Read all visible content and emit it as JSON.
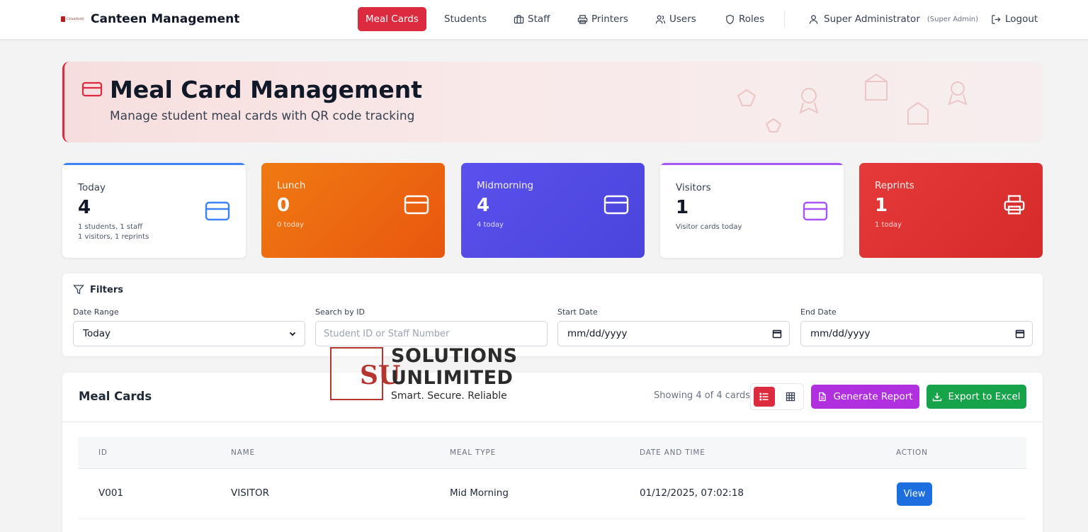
{
  "app": {
    "logo_text": "Crawford",
    "title": "Canteen Management"
  },
  "nav": {
    "items": [
      {
        "label": "Meal Cards",
        "icon": "none",
        "active": true
      },
      {
        "label": "Students",
        "icon": "none",
        "active": false
      },
      {
        "label": "Staff",
        "icon": "briefcase-icon",
        "active": false
      },
      {
        "label": "Printers",
        "icon": "printer-icon",
        "active": false
      },
      {
        "label": "Users",
        "icon": "users-icon",
        "active": false
      },
      {
        "label": "Roles",
        "icon": "shield-icon",
        "active": false
      }
    ],
    "user_name": "Super Administrator",
    "user_role": "(Super Admin)",
    "logout_label": "Logout"
  },
  "hero": {
    "title": "Meal Card Management",
    "subtitle": "Manage student meal cards with QR code tracking"
  },
  "stats": [
    {
      "label": "Today",
      "value": "4",
      "sub_lines": [
        "1 students, 1 staff",
        "1 visitors, 1 reprints"
      ],
      "style": "light",
      "accent": "#3b82f6",
      "icon": "card-icon"
    },
    {
      "label": "Lunch",
      "value": "0",
      "sub_lines": [
        "0 today"
      ],
      "style": "solid",
      "accent": "#ef6c0f",
      "icon": "card-icon"
    },
    {
      "label": "Midmorning",
      "value": "4",
      "sub_lines": [
        "4 today"
      ],
      "style": "solid",
      "accent": "#5148e5",
      "icon": "card-icon"
    },
    {
      "label": "Visitors",
      "value": "1",
      "sub_lines": [
        "Visitor cards today"
      ],
      "style": "light",
      "accent": "#a855f7",
      "icon": "card-icon"
    },
    {
      "label": "Reprints",
      "value": "1",
      "sub_lines": [
        "1 today"
      ],
      "style": "solid",
      "accent": "#dc2f2f",
      "icon": "printer-icon"
    }
  ],
  "filters": {
    "title": "Filters",
    "date_range": {
      "label": "Date Range",
      "value": "Today"
    },
    "search": {
      "label": "Search by ID",
      "placeholder": "Student ID or Staff Number"
    },
    "start_date": {
      "label": "Start Date",
      "value": "mm/dd/yyyy"
    },
    "end_date": {
      "label": "End Date",
      "value": "mm/dd/yyyy"
    }
  },
  "table": {
    "title": "Meal Cards",
    "showing": "Showing 4 of 4 cards",
    "report_label": "Generate Report",
    "export_label": "Export to Excel",
    "columns": [
      "ID",
      "NAME",
      "MEAL TYPE",
      "DATE AND TIME",
      "ACTION"
    ],
    "rows": [
      {
        "id": "V001",
        "name": "VISITOR",
        "meal_type": "Mid Morning",
        "datetime": "01/12/2025, 07:02:18",
        "action": "View"
      }
    ]
  },
  "watermark": {
    "monogram": "SU",
    "line1": "SOLUTIONS",
    "line2": "UNLIMITED",
    "tagline": "Smart. Secure. Reliable"
  },
  "colors": {
    "brand": "#dc2a3f",
    "report": "#b030e0",
    "export": "#16a34a",
    "view": "#1d6fe0"
  }
}
